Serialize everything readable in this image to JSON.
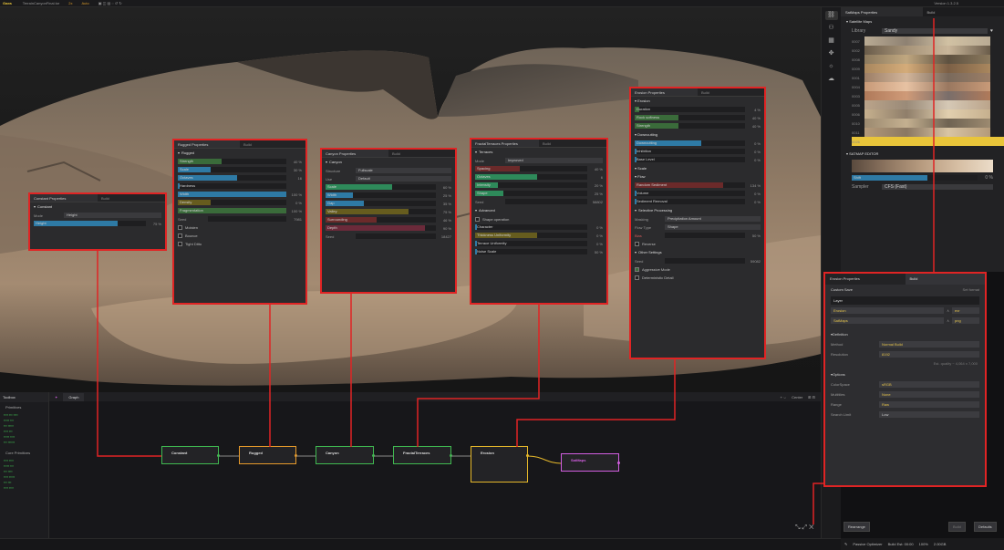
{
  "topbar": {
    "logo": "Gaea",
    "file": "TerrainCanyonFinal.tor",
    "scale": "2x",
    "status": "Auto",
    "version": "Version 1.3.2.5"
  },
  "viewport": {
    "label": "3D Terrain Viewport"
  },
  "constant_panel": {
    "title": "Constant Properties",
    "build_tab": "Build",
    "section": "Constant",
    "mode_label": "Mode",
    "mode_value": "Height",
    "rows": [
      {
        "label": "Height",
        "value": "75 %",
        "fill": 0.75,
        "color": "#2e7aa5"
      }
    ]
  },
  "rugged_panel": {
    "title": "Rugged Properties",
    "build_tab": "Build",
    "section": "Rugged",
    "rows": [
      {
        "label": "Strength",
        "value": "40 %",
        "fill": 0.4,
        "color": "#3a6b3a"
      },
      {
        "label": "Scale",
        "value": "30 %",
        "fill": 0.3,
        "color": "#2e7aa5"
      },
      {
        "label": "Octaves",
        "value": "16",
        "fill": 0.55,
        "color": "#2e7aa5"
      },
      {
        "label": "Hardness",
        "value": "",
        "fill": 0.0,
        "color": "#2e7aa5"
      },
      {
        "label": "Width",
        "value": "100 %",
        "fill": 1.0,
        "color": "#2e7aa5"
      },
      {
        "label": "Density",
        "value": "0 %",
        "fill": 0.3,
        "color": "#665c1e"
      },
      {
        "label": "Fragmentation",
        "value": "100 %",
        "fill": 1.0,
        "color": "#3a6b3a"
      }
    ],
    "seed_label": "Seed",
    "seed_value": "7981",
    "checks": [
      "Moisten",
      "Bounce",
      "Tight Ditto"
    ]
  },
  "canyon_panel": {
    "title": "Canyon Properties",
    "build_tab": "Build",
    "section": "Canyon",
    "structure_label": "Structure",
    "structure_value": "Fullscale",
    "use_label": "Use",
    "use_value": "Default",
    "rows": [
      {
        "label": "Scale",
        "value": "60 %",
        "fill": 0.6,
        "color": "#2e8a5a"
      },
      {
        "label": "Width",
        "value": "25 %",
        "fill": 0.25,
        "color": "#2e7aa5"
      },
      {
        "label": "Gap",
        "value": "35 %",
        "fill": 0.35,
        "color": "#2e7aa5"
      },
      {
        "label": "Valley",
        "value": "75 %",
        "fill": 0.75,
        "color": "#665c1e"
      },
      {
        "label": "Surrounding",
        "value": "46 %",
        "fill": 0.46,
        "color": "#6b2a2a"
      },
      {
        "label": "Depth",
        "value": "90 %",
        "fill": 0.9,
        "color": "#6b2a3a"
      }
    ],
    "seed_label": "Seed",
    "seed_value": "18427"
  },
  "fractal_panel": {
    "title": "FractalTerraces Properties",
    "build_tab": "Build",
    "section": "Terraces",
    "mode_label": "Mode",
    "mode_value": "Improved",
    "rows": [
      {
        "label": "Spacing",
        "value": "40 %",
        "fill": 0.4,
        "color": "#6b2a2a"
      },
      {
        "label": "Octaves",
        "value": "6",
        "fill": 0.55,
        "color": "#2e8a5a"
      },
      {
        "label": "Intensity",
        "value": "20 %",
        "fill": 0.2,
        "color": "#2e8a5a"
      },
      {
        "label": "Shape",
        "value": "25 %",
        "fill": 0.25,
        "color": "#2e8a5a"
      }
    ],
    "seed_label": "Seed",
    "seed_value": "58802",
    "advanced": "Advanced",
    "check": "Shape operation",
    "rows2": [
      {
        "label": "Character",
        "value": "0 %",
        "fill": 0.0,
        "color": "#2e7aa5"
      },
      {
        "label": "Thickness Uniformity",
        "value": "0 %",
        "fill": 0.55,
        "color": "#665c1e"
      },
      {
        "label": "Terrace Uniformity",
        "value": "0 %",
        "fill": 0.0,
        "color": "#2e7aa5"
      },
      {
        "label": "Noise Scale",
        "value": "50 %",
        "fill": 0.0,
        "color": "#2e7aa5"
      }
    ]
  },
  "erosion_panel": {
    "title": "Erosion Properties",
    "build_tab": "Build",
    "sections": [
      {
        "name": "Erosion",
        "rows": [
          {
            "label": "Duration",
            "value": "4 %",
            "fill": 0.04,
            "color": "#3a6b3a"
          },
          {
            "label": "Rock softness",
            "value": "40 %",
            "fill": 0.4,
            "color": "#3a6b3a"
          },
          {
            "label": "Strength",
            "value": "40 %",
            "fill": 0.4,
            "color": "#3a6b3a"
          }
        ]
      },
      {
        "name": "Downcutting",
        "rows": [
          {
            "label": "Downcutting",
            "value": "0 %",
            "fill": 0.6,
            "color": "#2e7aa5"
          },
          {
            "label": "Inhibition",
            "value": "0 %",
            "fill": 0.0,
            "color": "#2e7aa5"
          },
          {
            "label": "Base Level",
            "value": "0 %",
            "fill": 0.0,
            "color": "#2e7aa5"
          }
        ]
      },
      {
        "name": "Scale",
        "rows": []
      },
      {
        "name": "Flow",
        "rows": [
          {
            "label": "Random Sediment",
            "value": "134 %",
            "fill": 0.8,
            "color": "#6b2a2a"
          },
          {
            "label": "Volume",
            "value": "0 %",
            "fill": 0.0,
            "color": "#2e7aa5"
          },
          {
            "label": "Sediment Removal",
            "value": "0 %",
            "fill": 0.0,
            "color": "#2e7aa5"
          }
        ]
      }
    ],
    "selective": "Selective Processing",
    "masking_label": "Masking",
    "masking_value": "Precipitation Amount",
    "flow_label": "Flow Type",
    "flow_value": "Shape",
    "bias_label": "Bias",
    "bias_value": "50 %",
    "reverse": "Reverse",
    "other": "Other Settings",
    "seed_label": "Seed",
    "seed_value": "59082",
    "check1": "Aggressive Mode",
    "check2": "Deterministic Detail"
  },
  "satmap": {
    "tab1": "SatMaps Properties",
    "tab2": "Build",
    "section": "Satellite Maps",
    "library_label": "Library",
    "library_value": "Sandy",
    "maps": [
      {
        "name": "0007",
        "colors": [
          "#b9ab94",
          "#8e8172",
          "#d1c1a3"
        ]
      },
      {
        "name": "0002",
        "colors": [
          "#6a5c4a",
          "#a79479",
          "#c9b69a"
        ]
      },
      {
        "name": "0008",
        "colors": [
          "#8c7a5e",
          "#c0a780",
          "#5e5140"
        ]
      },
      {
        "name": "0009",
        "colors": [
          "#a9875e",
          "#d4ac7a",
          "#7c6046"
        ]
      },
      {
        "name": "0001",
        "colors": [
          "#9c7e66",
          "#d2b59a",
          "#7a6a5c"
        ]
      },
      {
        "name": "0004",
        "colors": [
          "#c89a78",
          "#e7c2a3",
          "#9a7860"
        ]
      },
      {
        "name": "0003",
        "colors": [
          "#b07a5a",
          "#cf9a78",
          "#7a6e6a"
        ]
      },
      {
        "name": "0005",
        "colors": [
          "#bba48a",
          "#9a8a78",
          "#d5c8b5"
        ]
      },
      {
        "name": "0006",
        "colors": [
          "#c6b08e",
          "#8f7e6a",
          "#e1cfae"
        ]
      },
      {
        "name": "0010",
        "colors": [
          "#9c8a70",
          "#c4b090",
          "#6f6352"
        ]
      },
      {
        "name": "0011",
        "colors": [
          "#b49a7a",
          "#8a7762",
          "#d8c4a4"
        ]
      },
      {
        "name": "0026",
        "colors": [
          "#e9c53a",
          "#e9c53a",
          "#e9c53a"
        ]
      }
    ],
    "editor": "SATMAP EDITOR",
    "shift_label": "Shift",
    "shift_value": "0 %",
    "sampler_label": "Sampler",
    "sampler_value": "CFS (Fast)"
  },
  "build_panel": {
    "tab1": "Erosion Properties",
    "tab2": "Build",
    "section": "Custom Save",
    "section_right": "Set format",
    "layer": "Layer",
    "outputs": [
      {
        "name": "Erosion",
        "fmt": "exr"
      },
      {
        "name": "SatMaps",
        "fmt": "png"
      }
    ],
    "definition": "Definition",
    "method_label": "Method",
    "method_value": "Normal Build",
    "resolution_label": "Resolution",
    "resolution_value": "8192",
    "estimate": "Est. quality ~ 4,064 x 7,000",
    "options": "Options",
    "colorspace_label": "ColorSpace",
    "colorspace_value": "sRGB",
    "multitile_label": "Multitiles",
    "multitile_value": "None",
    "range_label": "Range",
    "range_value": "Raw",
    "selmode_label": "Search Limit",
    "selmode_value": "Low"
  },
  "nodelib": {
    "title": "Toolbox",
    "section1": "Primitives",
    "section2": "Core Primitives"
  },
  "graph": {
    "tab": "Graph",
    "center": "Center",
    "nodes": [
      {
        "name": "Constant",
        "border": "#3fb950"
      },
      {
        "name": "Rugged",
        "border": "#e69a2a"
      },
      {
        "name": "Canyon",
        "border": "#3fb950"
      },
      {
        "name": "FractalTerraces",
        "border": "#3fb950"
      },
      {
        "name": "Erosion",
        "border": "#e6b82a"
      },
      {
        "name": "SatMaps",
        "border": "#d25ee0"
      }
    ]
  },
  "status": {
    "rearrange": "Rearrange",
    "build": "Build",
    "defaults": "Defaults",
    "passive": "Passive Optimizer",
    "build_time": "Build Est: 00:00",
    "mem": "100%",
    "size": "2.00GB"
  },
  "colors": {
    "accent": "#e02424",
    "brand": "#e9c53a"
  }
}
